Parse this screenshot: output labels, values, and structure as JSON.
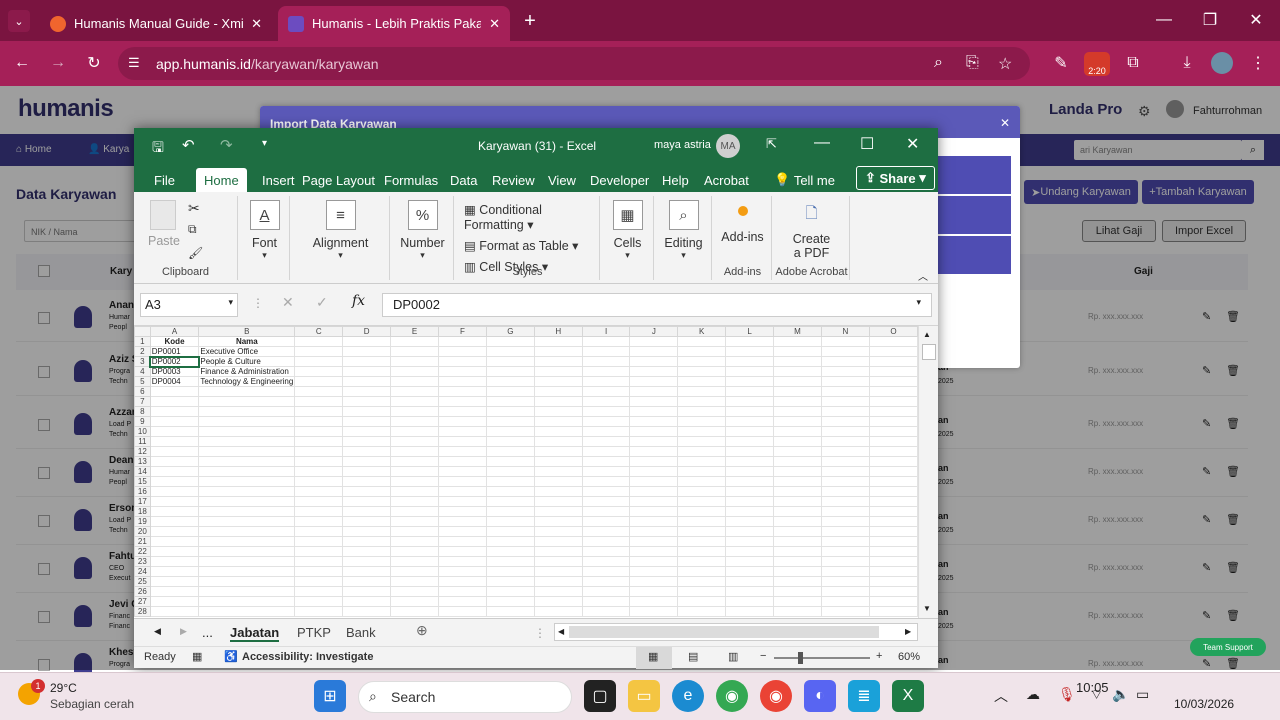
{
  "browser": {
    "tabs": [
      {
        "label": "Humanis Manual Guide - Xmind"
      },
      {
        "label": "Humanis - Lebih Praktis Pakai H"
      }
    ],
    "url_host": "app.humanis.id",
    "url_path": "/karyawan/karyawan",
    "ext_badge": "2:20"
  },
  "web": {
    "brand": "humanis",
    "company": "Landa Pro",
    "user": "Fahturrohman",
    "nav": [
      "Home",
      "Karya"
    ],
    "page_title": "Data Karyawan",
    "filter_placeholder": "NIK / Nama",
    "search_placeholder": "ari Karyawan",
    "buttons": {
      "invite": "Undang Karyawan",
      "add": "Tambah Karyawan",
      "salary": "Lihat Gaji",
      "import": "Impor Excel"
    },
    "col_name": "Kary",
    "col_salary": "Gaji",
    "salary_masked": "Rp. xxx.xxx.xxx",
    "rows": [
      {
        "name": "Anan",
        "l1": "Humar",
        "l2": "Peopl",
        "suffix": ""
      },
      {
        "name": "Aziz S",
        "l1": "Progra",
        "l2": "Techn",
        "suffix": "2025"
      },
      {
        "name": "Azzar",
        "l1": "Load P",
        "l2": "Techn",
        "suffix": "2025"
      },
      {
        "name": "Dean",
        "l1": "Humar",
        "l2": "Peopl",
        "suffix": "2025"
      },
      {
        "name": "Erson",
        "l1": "Load P",
        "l2": "Techn",
        "suffix": "2025"
      },
      {
        "name": "Fahtu",
        "l1": "CEO",
        "l2": "Execut",
        "suffix": "2025"
      },
      {
        "name": "Jevi C",
        "l1": "Financ",
        "l2": "Financ",
        "suffix": "2025"
      },
      {
        "name": "Khesy",
        "l1": "Progra",
        "l2": "",
        "suffix": ""
      }
    ],
    "row_tail": "an",
    "modal_title": "Import Data Karyawan",
    "support": "Team Support"
  },
  "excel": {
    "title": "Karyawan (31)  -  Excel",
    "user": "maya astria",
    "initials": "MA",
    "tabs": [
      "File",
      "Home",
      "Insert",
      "Page Layout",
      "Formulas",
      "Data",
      "Review",
      "View",
      "Developer",
      "Help",
      "Acrobat"
    ],
    "tell_me": "Tell me",
    "share": "Share",
    "ribbon": {
      "paste": "Paste",
      "clipboard": "Clipboard",
      "font": "Font",
      "alignment": "Alignment",
      "number": "Number",
      "cond_format": "Conditional Formatting",
      "format_table": "Format as Table",
      "cell_styles": "Cell Styles",
      "styles": "Styles",
      "cells": "Cells",
      "editing": "Editing",
      "addins": "Add-ins",
      "addins_group": "Add-ins",
      "create_pdf_1": "Create",
      "create_pdf_2": "a PDF",
      "adobe": "Adobe Acrobat"
    },
    "name_box": "A3",
    "formula": "DP0002",
    "columns": [
      "A",
      "B",
      "C",
      "D",
      "E",
      "F",
      "G",
      "H",
      "I",
      "J",
      "K",
      "L",
      "M",
      "N",
      "O"
    ],
    "header_row": [
      "Kode",
      "Nama"
    ],
    "rows": [
      [
        "DP0001",
        "Executive Office"
      ],
      [
        "DP0002",
        "People & Culture"
      ],
      [
        "DP0003",
        "Finance & Administration"
      ],
      [
        "DP0004",
        "Technology & Engineering"
      ]
    ],
    "row_count": 28,
    "sheets": [
      "...",
      "Jabatan",
      "PTKP",
      "Bank"
    ],
    "status_ready": "Ready",
    "accessibility": "Accessibility: Investigate",
    "zoom": "60%"
  },
  "taskbar": {
    "temp": "29°C",
    "weather": "Sebagian cerah",
    "search": "Search",
    "time": "10:05",
    "date": "10/03/2026"
  }
}
